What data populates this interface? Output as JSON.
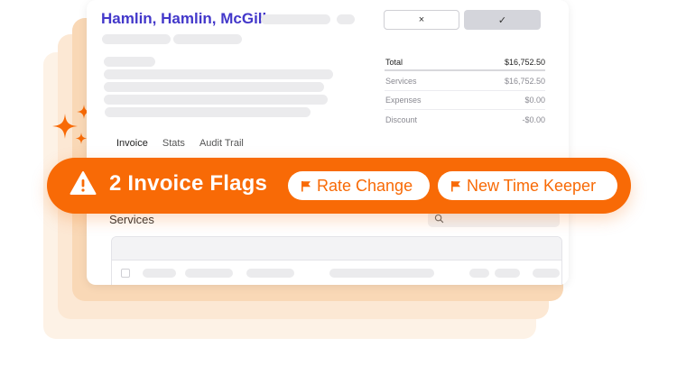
{
  "invoice": {
    "client_name": "Hamlin, Hamlin, McGill",
    "reject_icon": "×",
    "approve_icon": "✓"
  },
  "summary": {
    "rows": [
      {
        "label": "Total",
        "value": "$16,752.50"
      },
      {
        "label": "Services",
        "value": "$16,752.50"
      },
      {
        "label": "Expenses",
        "value": "$0.00"
      },
      {
        "label": "Discount",
        "value": "-$0.00"
      }
    ]
  },
  "tabs": [
    "Invoice",
    "Stats",
    "Audit Trail"
  ],
  "services": {
    "title": "Services"
  },
  "banner": {
    "flag_count_label": "2 Invoice Flags",
    "flags": [
      "Rate Change",
      "New Time Keeper"
    ]
  },
  "colors": {
    "accent": "#f86a06",
    "client_name": "#4338ca",
    "card": "#ffffff"
  },
  "icons": {
    "warning": "warning-triangle-icon",
    "flag": "flag-icon",
    "sparkles": "sparkles-icon",
    "search": "search-icon"
  }
}
